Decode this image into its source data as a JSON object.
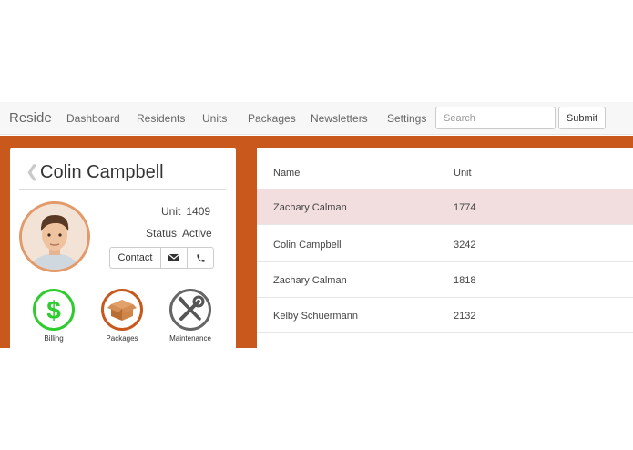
{
  "nav": {
    "brand": "Reside",
    "links": [
      "Dashboard",
      "Residents",
      "Units",
      "Packages",
      "Newsletters",
      "Settings"
    ],
    "search_placeholder": "Search",
    "submit_label": "Submit"
  },
  "profile": {
    "name": "Colin Campbell",
    "unit_label": "Unit",
    "unit_value": "1409",
    "status_label": "Status",
    "status_value": "Active",
    "contact_label": "Contact",
    "tiles": [
      {
        "label": "Billing",
        "icon": "dollar-icon",
        "color": "#2ecc2e"
      },
      {
        "label": "Packages",
        "icon": "package-box-icon",
        "color": "#c8581c"
      },
      {
        "label": "Maintenance",
        "icon": "tools-icon",
        "color": "#666666"
      }
    ]
  },
  "table": {
    "columns": [
      "Name",
      "Unit"
    ],
    "rows": [
      {
        "name": "Zachary Calman",
        "unit": "1774",
        "selected": true
      },
      {
        "name": "Colin Campbell",
        "unit": "3242",
        "selected": false
      },
      {
        "name": "Zachary Calman",
        "unit": "1818",
        "selected": false
      },
      {
        "name": "Kelby Schuermann",
        "unit": "2132",
        "selected": false
      }
    ]
  },
  "colors": {
    "accent": "#c8581c",
    "selected_row": "#f2dede"
  }
}
